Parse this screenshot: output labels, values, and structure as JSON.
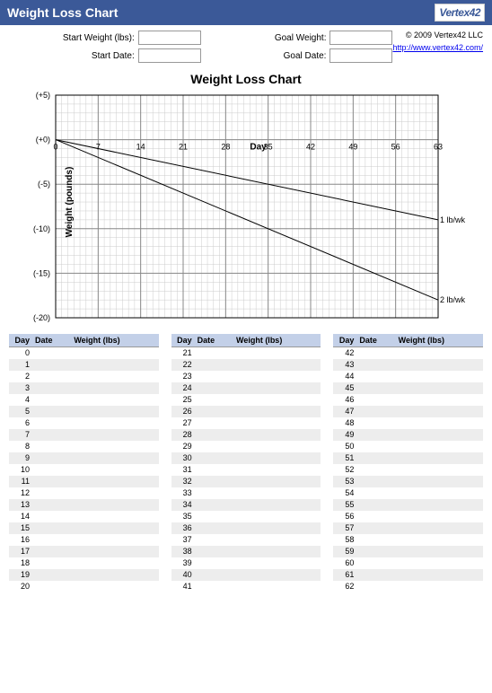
{
  "titlebar": {
    "title": "Weight Loss Chart",
    "logo_text": "Vertex42"
  },
  "header": {
    "start_weight_label": "Start Weight (lbs):",
    "start_date_label": "Start Date:",
    "goal_weight_label": "Goal Weight:",
    "goal_date_label": "Goal Date:",
    "start_weight_value": "",
    "start_date_value": "",
    "goal_weight_value": "",
    "goal_date_value": "",
    "copyright": "© 2009 Vertex42 LLC",
    "link_text": "http://www.vertex42.com/"
  },
  "chart_data": {
    "type": "line",
    "title": "Weight Loss Chart",
    "xlabel": "Day",
    "ylabel": "Weight (pounds)",
    "xlim": [
      0,
      63
    ],
    "ylim": [
      -20,
      5
    ],
    "x_ticks": [
      0,
      7,
      14,
      21,
      28,
      35,
      42,
      49,
      56,
      63
    ],
    "y_ticks": [
      5,
      0,
      -5,
      -10,
      -15,
      -20
    ],
    "y_tick_labels": [
      "(+5)",
      "(+0)",
      "(-5)",
      "(-10)",
      "(-15)",
      "(-20)"
    ],
    "series": [
      {
        "name": "1 lb/wk",
        "x": [
          0,
          63
        ],
        "y": [
          0,
          -9
        ]
      },
      {
        "name": "2 lb/wk",
        "x": [
          0,
          63
        ],
        "y": [
          0,
          -18
        ]
      }
    ]
  },
  "table": {
    "headers": {
      "day": "Day",
      "date": "Date",
      "weight": "Weight (lbs)"
    },
    "columns": [
      [
        0,
        1,
        2,
        3,
        4,
        5,
        6,
        7,
        8,
        9,
        10,
        11,
        12,
        13,
        14,
        15,
        16,
        17,
        18,
        19,
        20
      ],
      [
        21,
        22,
        23,
        24,
        25,
        26,
        27,
        28,
        29,
        30,
        31,
        32,
        33,
        34,
        35,
        36,
        37,
        38,
        39,
        40,
        41
      ],
      [
        42,
        43,
        44,
        45,
        46,
        47,
        48,
        49,
        50,
        51,
        52,
        53,
        54,
        55,
        56,
        57,
        58,
        59,
        60,
        61,
        62
      ]
    ]
  }
}
